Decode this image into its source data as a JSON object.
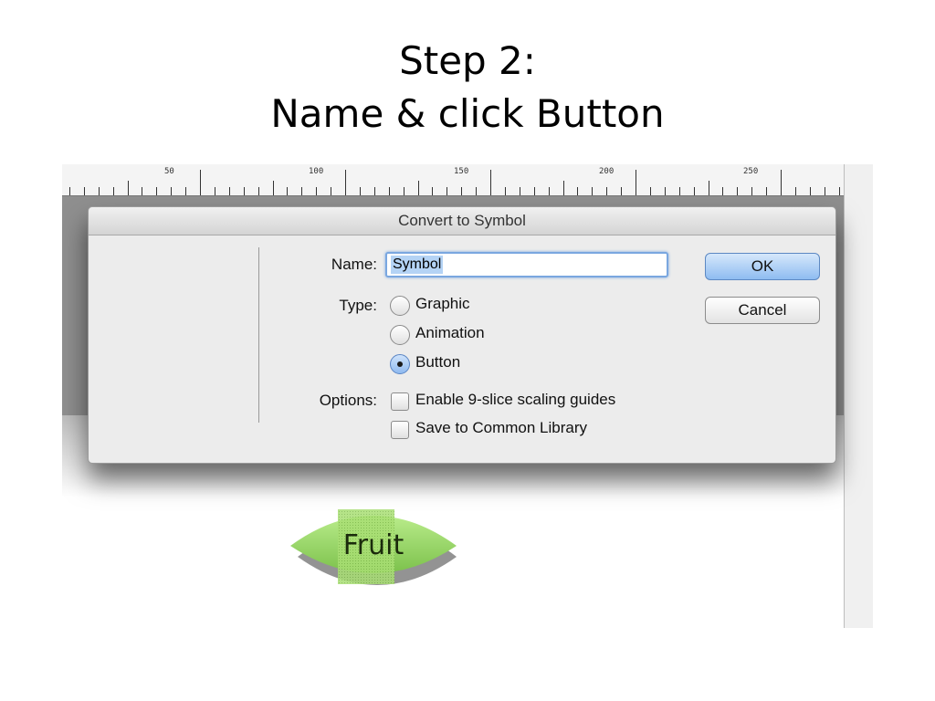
{
  "slide": {
    "title_line1": "Step 2:",
    "title_line2": "Name & click Button"
  },
  "ruler": {
    "labels": [
      "50",
      "100",
      "150",
      "200",
      "250"
    ]
  },
  "dialog": {
    "title": "Convert to Symbol",
    "name_label": "Name:",
    "name_value": "Symbol",
    "type_label": "Type:",
    "type_options": [
      {
        "label": "Graphic",
        "selected": false
      },
      {
        "label": "Animation",
        "selected": false
      },
      {
        "label": "Button",
        "selected": true
      }
    ],
    "options_label": "Options:",
    "checkboxes": [
      {
        "label": "Enable 9-slice scaling guides",
        "checked": false
      },
      {
        "label": "Save to Common Library",
        "checked": false
      }
    ],
    "ok_label": "OK",
    "cancel_label": "Cancel"
  },
  "stage": {
    "fruit_label": "Fruit"
  },
  "colors": {
    "accent": "#8ebcf1",
    "fruit_green": "#9bd86a",
    "panel_gray": "#8f8f8f"
  }
}
